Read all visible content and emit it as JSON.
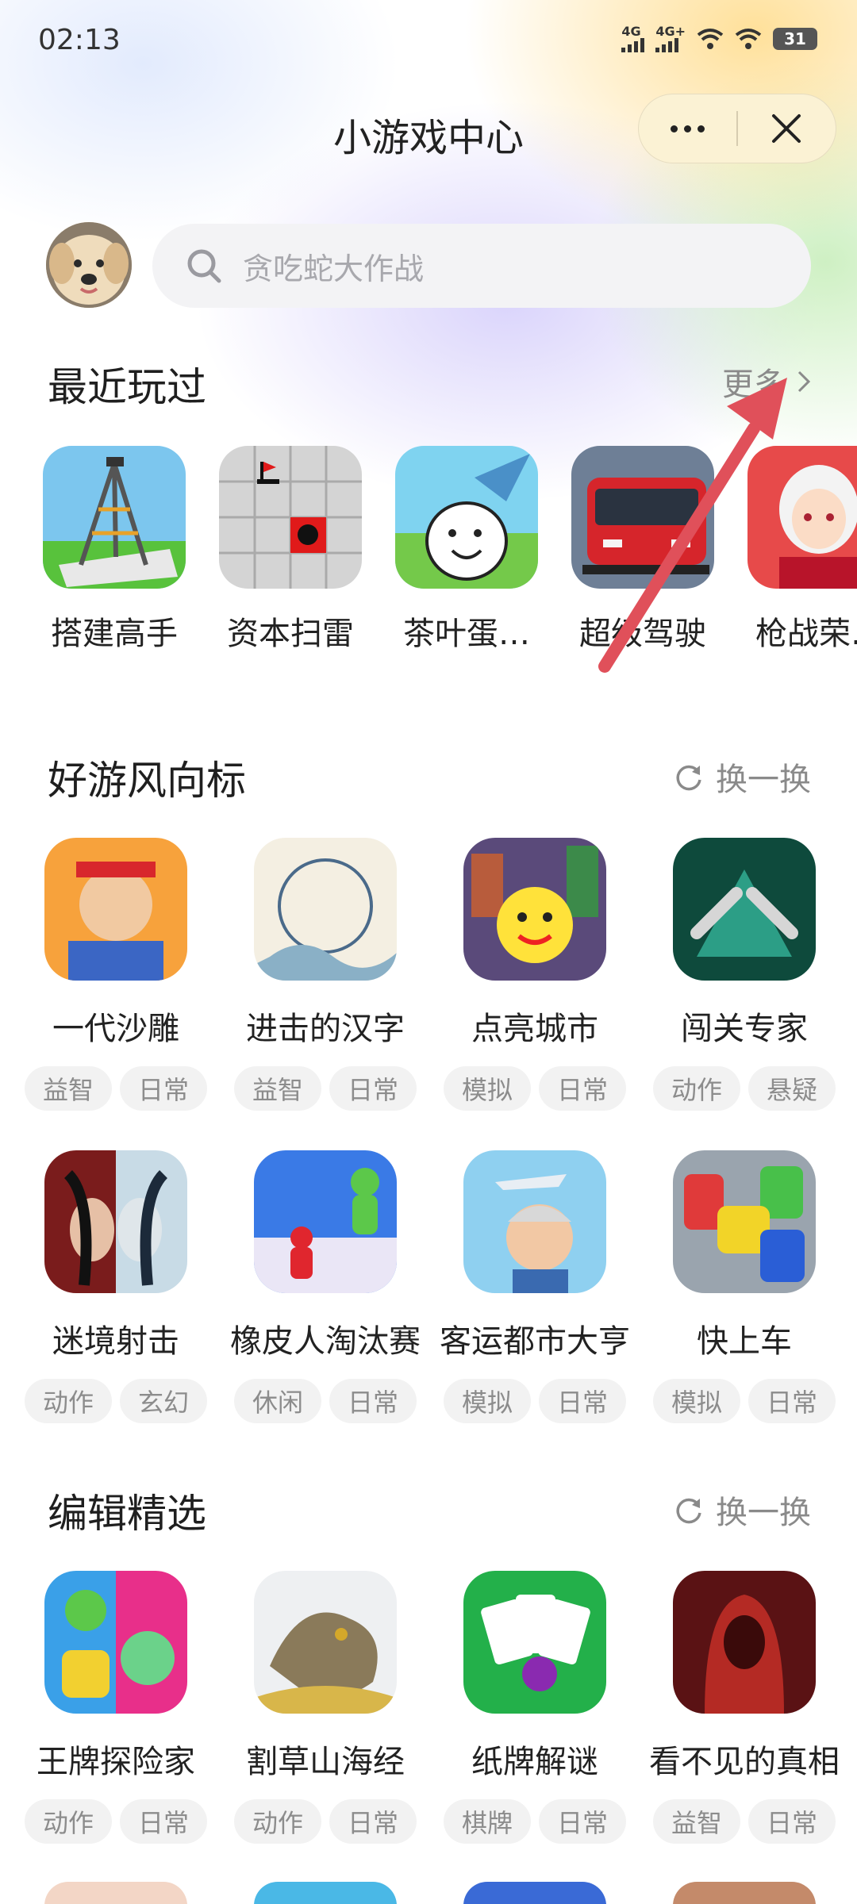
{
  "status": {
    "time": "02:13",
    "sim1": "4G",
    "sim2": "4G+",
    "battery": "31"
  },
  "header": {
    "title": "小游戏中心",
    "more_icon": "more-dots-icon",
    "close_icon": "close-icon"
  },
  "search": {
    "placeholder": "贪吃蛇大作战"
  },
  "recent": {
    "title": "最近玩过",
    "more": "更多",
    "items": [
      {
        "name": "搭建高手",
        "icon": "tripod-tower-game-icon"
      },
      {
        "name": "资本扫雷",
        "icon": "minesweeper-game-icon"
      },
      {
        "name": "茶叶蛋…",
        "icon": "tea-egg-game-icon"
      },
      {
        "name": "超级驾驶",
        "icon": "red-bus-game-icon"
      },
      {
        "name": "枪战荣…",
        "icon": "anime-girl-game-icon"
      }
    ]
  },
  "trending": {
    "title": "好游风向标",
    "refresh": "换一换",
    "items": [
      {
        "name": "一代沙雕",
        "tags": [
          "益智",
          "日常"
        ]
      },
      {
        "name": "进击的汉字",
        "tags": [
          "益智",
          "日常"
        ]
      },
      {
        "name": "点亮城市",
        "tags": [
          "模拟",
          "日常"
        ]
      },
      {
        "name": "闯关专家",
        "tags": [
          "动作",
          "悬疑"
        ]
      },
      {
        "name": "迷境射击",
        "tags": [
          "动作",
          "玄幻"
        ]
      },
      {
        "name": "橡皮人淘汰赛",
        "tags": [
          "休闲",
          "日常"
        ]
      },
      {
        "name": "客运都市大亨",
        "tags": [
          "模拟",
          "日常"
        ]
      },
      {
        "name": "快上车",
        "tags": [
          "模拟",
          "日常"
        ]
      }
    ]
  },
  "editor": {
    "title": "编辑精选",
    "refresh": "换一换",
    "items": [
      {
        "name": "王牌探险家",
        "tags": [
          "动作",
          "日常"
        ]
      },
      {
        "name": "割草山海经",
        "tags": [
          "动作",
          "日常"
        ]
      },
      {
        "name": "纸牌解谜",
        "tags": [
          "棋牌",
          "日常"
        ]
      },
      {
        "name": "看不见的真相",
        "tags": [
          "益智",
          "日常"
        ]
      }
    ]
  },
  "colors": {
    "accent_arrow": "#e0505a",
    "tag_bg": "#f2f2f2",
    "capsule_bg": "#fbf2d4"
  }
}
